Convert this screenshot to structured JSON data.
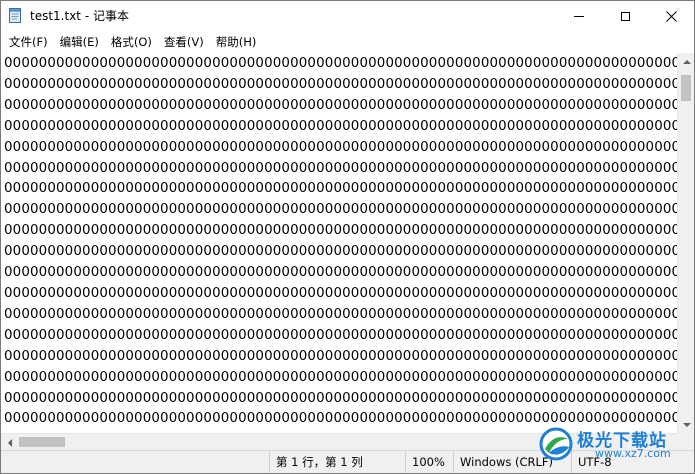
{
  "window": {
    "title": "test1.txt - 记事本",
    "icon": "notepad-icon"
  },
  "controls": {
    "minimize_icon": "minimize-icon",
    "maximize_icon": "maximize-icon",
    "close_icon": "close-icon",
    "close_glyph": "✕"
  },
  "menu": {
    "items": [
      {
        "label": "文件(F)"
      },
      {
        "label": "编辑(E)"
      },
      {
        "label": "格式(O)"
      },
      {
        "label": "查看(V)"
      },
      {
        "label": "帮助(H)"
      }
    ]
  },
  "editor": {
    "line_text": "000000000000000000000000000000000000000000000000000000000000000000000000000000000",
    "line_count": 18
  },
  "status": {
    "position": "第 1 行，第 1 列",
    "zoom": "100%",
    "line_ending": "Windows (CRLF)",
    "encoding": "UTF-8"
  },
  "watermark": {
    "text": "极光下载站",
    "url": "www.xz7.com"
  },
  "colors": {
    "watermark": "#1e7fd6",
    "scroll_thumb": "#c2c2c2",
    "statusbar_bg": "#f0f0f0"
  }
}
